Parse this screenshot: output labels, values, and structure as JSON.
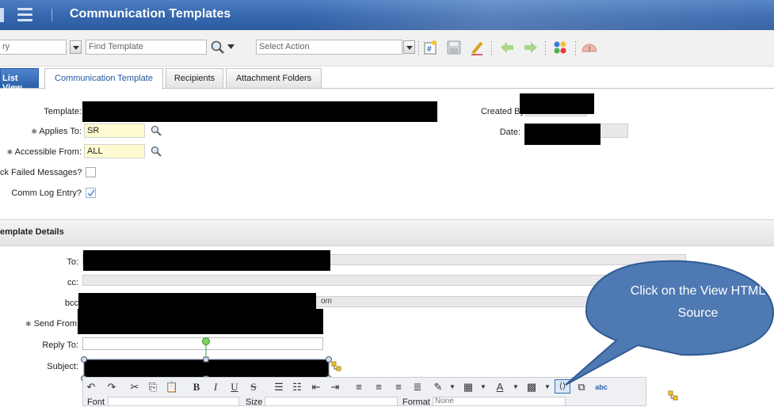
{
  "app": {
    "title": "Communication Templates"
  },
  "toolbar": {
    "query_value": "ry",
    "find_placeholder": "Find Template",
    "action_placeholder": "Select Action"
  },
  "tabs": [
    {
      "label": "List View"
    },
    {
      "label": "Communication Template"
    },
    {
      "label": "Recipients"
    },
    {
      "label": "Attachment Folders"
    }
  ],
  "form": {
    "template_label": "Template:",
    "applies_to_label": "Applies To:",
    "applies_to_value": "SR",
    "accessible_from_label": "Accessible From:",
    "accessible_from_value": "ALL",
    "track_failed_label": "ck Failed Messages?",
    "comm_log_label": "Comm Log Entry?",
    "created_by_label": "Created By",
    "date_label": "Date:",
    "required_marker": "✱"
  },
  "details": {
    "section_title": "emplate Details",
    "to_label": "To:",
    "cc_label": "cc:",
    "bcc_label": "bcc",
    "bcc_suffix": "om",
    "send_from_label": "Send From",
    "reply_to_label": "Reply To:",
    "subject_label": "Subject:"
  },
  "editor": {
    "font_label": "Font",
    "size_label": "Size",
    "format_label": "Format",
    "format_value": "None"
  },
  "callout": {
    "text": "Click on the View HTML Source"
  },
  "colors": {
    "titlebar": "#3566ad",
    "accent": "#1f57a3",
    "callout": "#4f79b3"
  }
}
